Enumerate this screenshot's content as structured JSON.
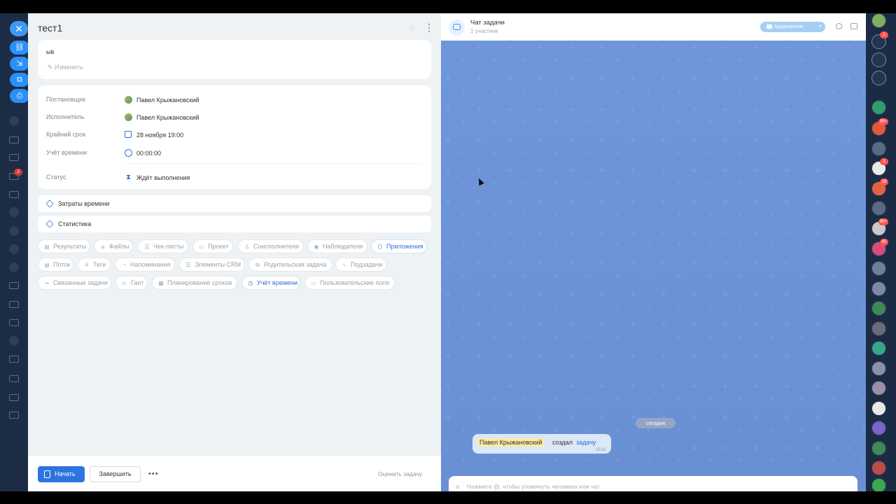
{
  "task": {
    "title": "тест1",
    "description": "ыв",
    "edit_label": "Изменить",
    "fields": [
      {
        "label": "Постановщик",
        "value": "Павел Крыжановский",
        "icon": "avatar"
      },
      {
        "label": "Исполнитель",
        "value": "Павел Крыжановский",
        "icon": "avatar"
      },
      {
        "label": "Крайний срок",
        "value": "28 ноября 19:00",
        "icon": "calendar-icon"
      },
      {
        "label": "Учёт времени",
        "value": "00:00:00",
        "icon": "clock-icon"
      },
      {
        "label": "Статус",
        "value": "Ждёт выполнения",
        "icon": "hourglass-icon"
      }
    ],
    "sections": [
      {
        "label": "Затраты времени",
        "icon": "cube-icon"
      },
      {
        "label": "Статистика",
        "icon": "cube-icon"
      }
    ],
    "chips": [
      {
        "label": "Результаты",
        "icon": "▤",
        "active": false
      },
      {
        "label": "Файлы",
        "icon": "⌀",
        "active": false
      },
      {
        "label": "Чек-листы",
        "icon": "☰",
        "active": false
      },
      {
        "label": "Проект",
        "icon": "▭",
        "active": false
      },
      {
        "label": "Соисполнители",
        "icon": "♙",
        "active": false
      },
      {
        "label": "Наблюдатели",
        "icon": "◉",
        "active": false
      },
      {
        "label": "Приложения",
        "icon": "⬡",
        "active": true
      },
      {
        "label": "Поток",
        "icon": "▤",
        "active": false
      },
      {
        "label": "Теги",
        "icon": "#",
        "active": false
      },
      {
        "label": "Напоминания",
        "icon": "◔",
        "active": false
      },
      {
        "label": "Элементы CRM",
        "icon": "☰",
        "active": false
      },
      {
        "label": "Родительская задача",
        "icon": "⧉",
        "active": false
      },
      {
        "label": "Подзадачи",
        "icon": "⤷",
        "active": false
      },
      {
        "label": "Связанные задачи",
        "icon": "∞",
        "active": false
      },
      {
        "label": "Гант",
        "icon": "⊏",
        "active": false
      },
      {
        "label": "Планирование сроков",
        "icon": "▦",
        "active": false
      },
      {
        "label": "Учёт времени",
        "icon": "◷",
        "active": true
      },
      {
        "label": "Пользовательские поля",
        "icon": "▭",
        "active": false
      }
    ],
    "footer": {
      "start_label": "Начать",
      "finish_label": "Завершить",
      "more_label": "•••",
      "rate_label": "Оценить задачу"
    }
  },
  "chat": {
    "title": "Чат задачи",
    "subtitle": "1 участник",
    "audio_label": "Аудиозвонок",
    "date_divider": "сегодня",
    "system_message": {
      "author": "Павел Крыжановский",
      "verb": "создал",
      "link": "задачу",
      "time": "15:11"
    },
    "input_placeholder": "Нажмите @, чтобы упомянуть человека или чат"
  },
  "right_sidebar": {
    "badges": [
      "1",
      "99+",
      "1",
      "19",
      "99+",
      "40"
    ]
  },
  "left_nav": {
    "counter": "2"
  },
  "colors": {
    "accent": "#2e74e1",
    "chat_bg": "#6c94da",
    "panel_bg": "#eef2f4"
  }
}
